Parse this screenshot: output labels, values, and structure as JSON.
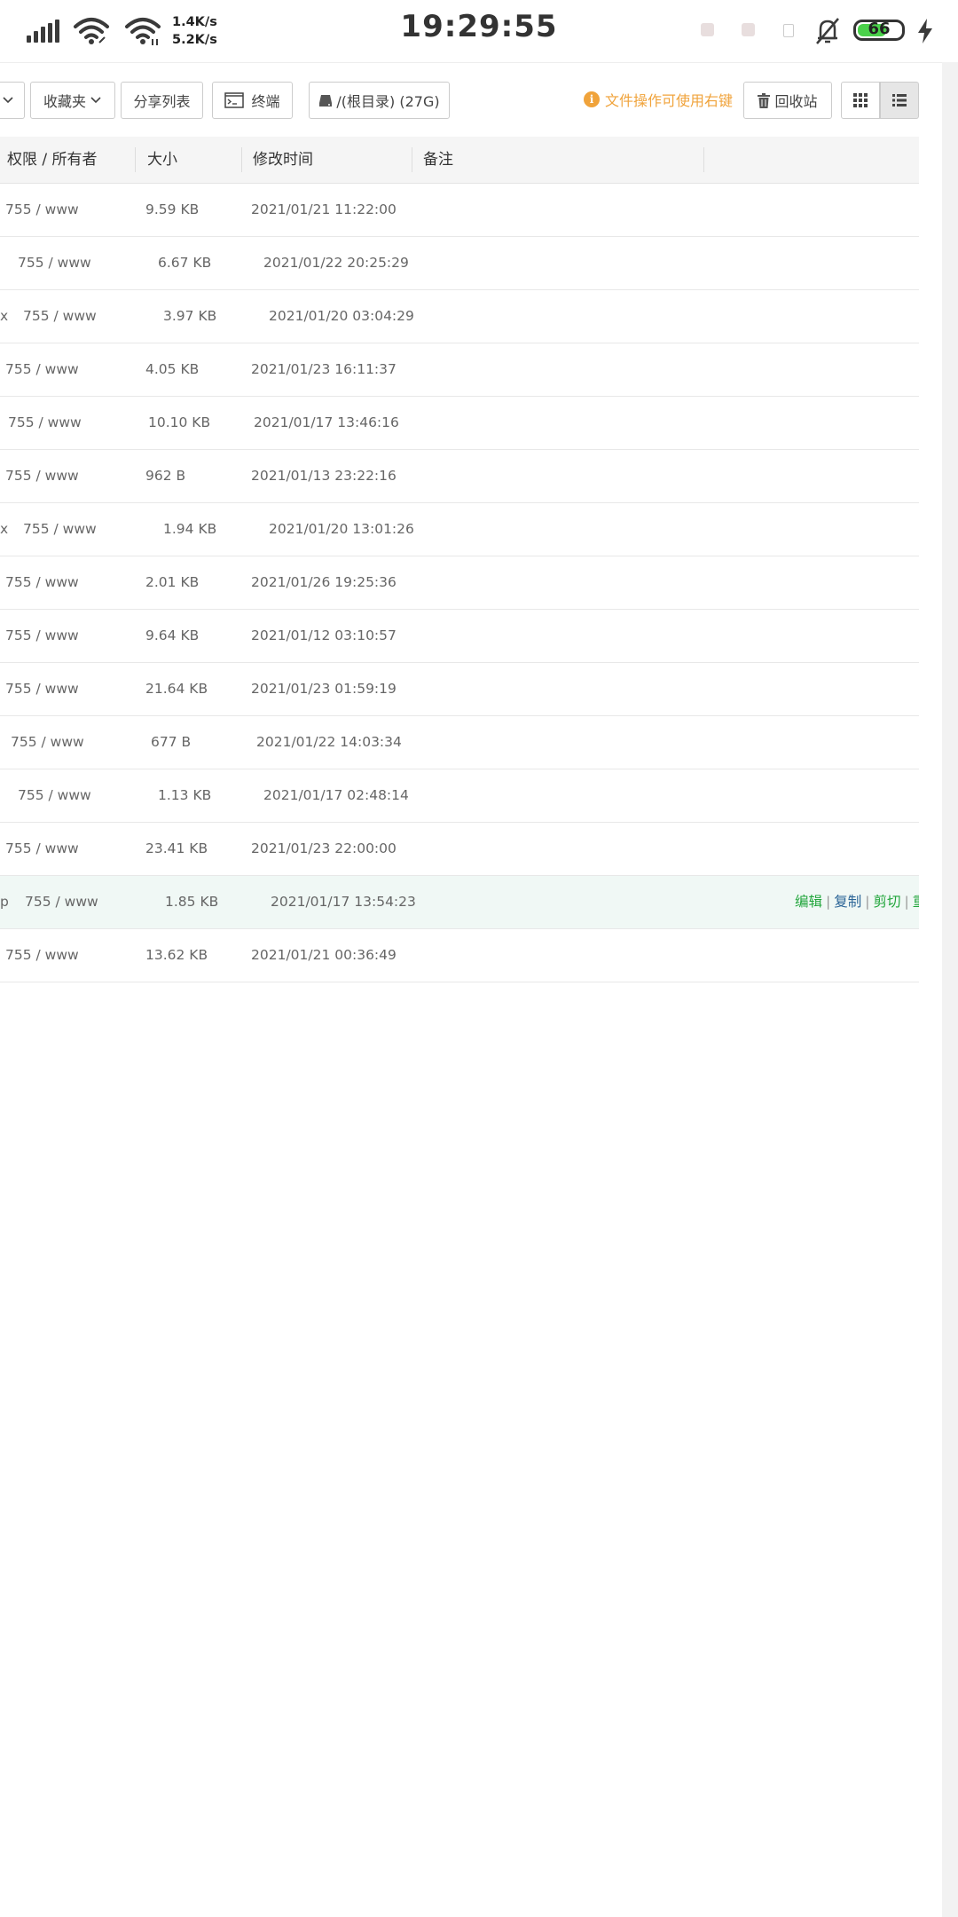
{
  "status_bar": {
    "time": "19:29:55",
    "upload_speed": "1.4K/s",
    "download_speed": "5.2K/s",
    "battery_level": "66",
    "battery_color": "#4ad14a"
  },
  "toolbar": {
    "favorites_label": "收藏夹",
    "share_list_label": "分享列表",
    "terminal_label": "终端",
    "root_dir_label": "/(根目录) (27G)",
    "hint_text": "文件操作可使用右键",
    "recycle_label": "回收站",
    "hint_color": "#f0a33b"
  },
  "table": {
    "headers": {
      "perm_owner": "权限 / 所有者",
      "size": "大小",
      "modified": "修改时间",
      "note": "备注"
    },
    "rows": [
      {
        "prefix": "",
        "perm": "755 / www",
        "size": "9.59 KB",
        "time": "2021/01/21 11:22:00"
      },
      {
        "prefix": "",
        "perm": "755 / www",
        "size": "6.67 KB",
        "time": "2021/01/22 20:25:29"
      },
      {
        "prefix": "x",
        "perm": "755 / www",
        "size": "3.97 KB",
        "time": "2021/01/20 03:04:29"
      },
      {
        "prefix": "",
        "perm": "755 / www",
        "size": "4.05 KB",
        "time": "2021/01/23 16:11:37"
      },
      {
        "prefix": "",
        "perm": "755 / www",
        "size": "10.10 KB",
        "time": "2021/01/17 13:46:16"
      },
      {
        "prefix": "",
        "perm": "755 / www",
        "size": "962 B",
        "time": "2021/01/13 23:22:16"
      },
      {
        "prefix": "x",
        "perm": "755 / www",
        "size": "1.94 KB",
        "time": "2021/01/20 13:01:26"
      },
      {
        "prefix": "",
        "perm": "755 / www",
        "size": "2.01 KB",
        "time": "2021/01/26 19:25:36"
      },
      {
        "prefix": "",
        "perm": "755 / www",
        "size": "9.64 KB",
        "time": "2021/01/12 03:10:57"
      },
      {
        "prefix": "",
        "perm": "755 / www",
        "size": "21.64 KB",
        "time": "2021/01/23 01:59:19"
      },
      {
        "prefix": "",
        "perm": "755 / www",
        "size": "677 B",
        "time": "2021/01/22 14:03:34"
      },
      {
        "prefix": "",
        "perm": "755 / www",
        "size": "1.13 KB",
        "time": "2021/01/17 02:48:14"
      },
      {
        "prefix": "",
        "perm": "755 / www",
        "size": "23.41 KB",
        "time": "2021/01/23 22:00:00"
      },
      {
        "prefix": "p",
        "perm": "755 / www",
        "size": "1.85 KB",
        "time": "2021/01/17 13:54:23"
      },
      {
        "prefix": "",
        "perm": "755 / www",
        "size": "13.62 KB",
        "time": "2021/01/21 00:36:49"
      }
    ],
    "row_actions": {
      "edit": "编辑",
      "copy": "复制",
      "cut": "剪切",
      "more": "重"
    }
  }
}
